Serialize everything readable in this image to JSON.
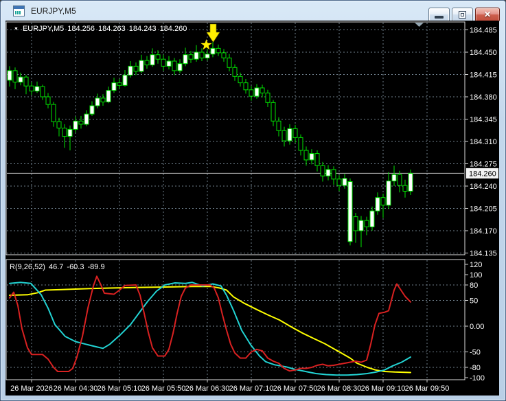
{
  "window": {
    "title": "EURJPY,M5",
    "close_glyph": "✕"
  },
  "colors": {
    "background": "#000000",
    "grid": "#6f7f8c",
    "pane_border": "#dcdcdc",
    "axis_text": "#ffffff",
    "candle_stroke": "#00e400",
    "candle_bull_fill": "#ffffff",
    "candle_bear_fill": "#000000",
    "current_price_line": "#bdbdbd",
    "price_tag_bg": "#f2f2f2",
    "price_tag_text": "#000000",
    "indicator_red": "#d92121",
    "indicator_cyan": "#22d3d3",
    "indicator_yellow": "#ffff00",
    "marker_yellow": "#ffee00",
    "shift_marker": "#93a5b1"
  },
  "chart_data": {
    "type": "candlestick",
    "title": "EURJPY,M5",
    "timeframe_minutes": 5,
    "info": {
      "dropdown_glyph": "▼",
      "symbol": "EURJPY,M5",
      "open": "184.256",
      "high": "184.263",
      "low": "184.243",
      "close": "184.260"
    },
    "current_price": 184.26,
    "current_price_label": "184.260",
    "price_axis": {
      "labels": [
        "184.485",
        "184.450",
        "184.415",
        "184.380",
        "184.345",
        "184.310",
        "184.275",
        "184.240",
        "184.205",
        "184.170",
        "184.135"
      ],
      "min": 184.135,
      "max": 184.485,
      "step": 0.035
    },
    "time_axis": {
      "labels": [
        "26 Mar 2026",
        "26 Mar 04:30",
        "26 Mar 05:10",
        "26 Mar 05:50",
        "26 Mar 06:30",
        "26 Mar 07:10",
        "26 Mar 07:50",
        "26 Mar 08:30",
        "26 Mar 09:10",
        "26 Mar 09:50"
      ]
    },
    "candles": [
      [
        184.406,
        184.428,
        184.396,
        184.421
      ],
      [
        184.421,
        184.426,
        184.392,
        184.403
      ],
      [
        184.403,
        184.418,
        184.398,
        184.411
      ],
      [
        184.411,
        184.414,
        184.384,
        184.397
      ],
      [
        184.397,
        184.403,
        184.383,
        184.389
      ],
      [
        184.389,
        184.404,
        184.386,
        184.396
      ],
      [
        184.396,
        184.399,
        184.375,
        184.38
      ],
      [
        184.38,
        184.386,
        184.362,
        184.368
      ],
      [
        184.368,
        184.372,
        184.333,
        184.341
      ],
      [
        184.341,
        184.347,
        184.318,
        184.331
      ],
      [
        184.331,
        184.337,
        184.3,
        184.318
      ],
      [
        184.318,
        184.335,
        184.296,
        184.329
      ],
      [
        184.329,
        184.349,
        184.324,
        184.342
      ],
      [
        184.342,
        184.35,
        184.33,
        184.337
      ],
      [
        184.337,
        184.359,
        184.334,
        184.353
      ],
      [
        184.353,
        184.373,
        184.35,
        184.366
      ],
      [
        184.366,
        184.385,
        184.362,
        184.378
      ],
      [
        184.378,
        184.384,
        184.366,
        184.372
      ],
      [
        184.372,
        184.396,
        184.37,
        184.39
      ],
      [
        184.39,
        184.41,
        184.386,
        184.402
      ],
      [
        184.402,
        184.408,
        184.392,
        184.398
      ],
      [
        184.398,
        184.422,
        184.396,
        184.414
      ],
      [
        184.414,
        184.436,
        184.41,
        184.428
      ],
      [
        184.428,
        184.434,
        184.414,
        184.42
      ],
      [
        184.42,
        184.446,
        184.417,
        184.437
      ],
      [
        184.437,
        184.444,
        184.424,
        184.43
      ],
      [
        184.43,
        184.456,
        184.427,
        184.446
      ],
      [
        184.446,
        184.453,
        184.432,
        184.439
      ],
      [
        184.439,
        184.446,
        184.421,
        184.428
      ],
      [
        184.428,
        184.444,
        184.423,
        184.436
      ],
      [
        184.436,
        184.441,
        184.414,
        184.421
      ],
      [
        184.421,
        184.439,
        184.417,
        184.432
      ],
      [
        184.432,
        184.457,
        184.428,
        184.446
      ],
      [
        184.446,
        184.452,
        184.433,
        184.439
      ],
      [
        184.439,
        184.461,
        184.435,
        184.45
      ],
      [
        184.45,
        184.456,
        184.436,
        184.441
      ],
      [
        184.441,
        184.455,
        184.437,
        184.447
      ],
      [
        184.447,
        184.466,
        184.442,
        184.456
      ],
      [
        184.456,
        184.462,
        184.444,
        184.449
      ],
      [
        184.449,
        184.455,
        184.435,
        184.441
      ],
      [
        184.441,
        184.447,
        184.42,
        184.426
      ],
      [
        184.426,
        184.431,
        184.405,
        184.412
      ],
      [
        184.412,
        184.418,
        184.396,
        184.402
      ],
      [
        184.402,
        184.408,
        184.385,
        184.391
      ],
      [
        184.391,
        184.397,
        184.374,
        184.381
      ],
      [
        184.381,
        184.4,
        184.377,
        184.394
      ],
      [
        184.394,
        184.399,
        184.379,
        184.386
      ],
      [
        184.386,
        184.391,
        184.364,
        184.371
      ],
      [
        184.371,
        184.375,
        184.334,
        184.342
      ],
      [
        184.342,
        184.348,
        184.318,
        184.327
      ],
      [
        184.327,
        184.333,
        184.302,
        184.311
      ],
      [
        184.311,
        184.337,
        184.305,
        184.33
      ],
      [
        184.33,
        184.336,
        184.308,
        184.316
      ],
      [
        184.316,
        184.321,
        184.288,
        184.296
      ],
      [
        184.296,
        184.302,
        184.272,
        184.281
      ],
      [
        184.281,
        184.298,
        184.274,
        184.291
      ],
      [
        184.291,
        184.296,
        184.263,
        184.272
      ],
      [
        184.272,
        184.278,
        184.247,
        184.256
      ],
      [
        184.256,
        184.273,
        184.249,
        184.266
      ],
      [
        184.266,
        184.271,
        184.242,
        184.251
      ],
      [
        184.251,
        184.257,
        184.232,
        184.241
      ],
      [
        184.241,
        184.259,
        184.236,
        184.252
      ],
      [
        184.153,
        184.252,
        184.147,
        184.247
      ],
      [
        184.192,
        184.198,
        184.151,
        184.17
      ],
      [
        184.17,
        184.193,
        184.144,
        184.186
      ],
      [
        184.186,
        184.192,
        184.163,
        184.176
      ],
      [
        184.176,
        184.208,
        184.17,
        184.201
      ],
      [
        184.201,
        184.23,
        184.195,
        184.222
      ],
      [
        184.222,
        184.228,
        184.19,
        184.21
      ],
      [
        184.21,
        184.262,
        184.204,
        184.248
      ],
      [
        184.248,
        184.272,
        184.24,
        184.258
      ],
      [
        184.258,
        184.264,
        184.23,
        184.241
      ],
      [
        184.241,
        184.25,
        184.222,
        184.232
      ],
      [
        184.232,
        184.266,
        184.226,
        184.26
      ]
    ],
    "markers": [
      {
        "type": "arrow-down",
        "bar_index": 37,
        "color": "#ffee00"
      },
      {
        "type": "star",
        "bar_index": 36,
        "color": "#ffee00"
      }
    ],
    "indicator_pane": {
      "label": "R(9,26,52)",
      "current_values": [
        "46.7",
        "-60.3",
        "-89.9"
      ],
      "axis_labels": [
        "120",
        "100",
        "80",
        "50",
        "0.00",
        "-50",
        "-80",
        "-100"
      ],
      "axis_range": [
        -100,
        129
      ],
      "grid_levels": [
        80,
        50,
        0,
        -50,
        -80
      ],
      "series": [
        {
          "name": "r9",
          "color": "#d92121",
          "points": [
            [
              14,
              55
            ],
            [
              20,
              66
            ],
            [
              26,
              40
            ],
            [
              32,
              -5
            ],
            [
              40,
              -42
            ],
            [
              46,
              -55
            ],
            [
              62,
              -55
            ],
            [
              70,
              -64
            ],
            [
              78,
              -80
            ],
            [
              84,
              -88
            ],
            [
              100,
              -88
            ],
            [
              106,
              -82
            ],
            [
              112,
              -60
            ],
            [
              120,
              -20
            ],
            [
              128,
              35
            ],
            [
              136,
              78
            ],
            [
              141,
              97
            ],
            [
              147,
              80
            ],
            [
              152,
              64
            ],
            [
              166,
              62
            ],
            [
              174,
              70
            ],
            [
              182,
              79
            ],
            [
              198,
              80
            ],
            [
              204,
              60
            ],
            [
              210,
              25
            ],
            [
              216,
              -12
            ],
            [
              222,
              -42
            ],
            [
              230,
              -58
            ],
            [
              240,
              -58
            ],
            [
              246,
              -45
            ],
            [
              252,
              -14
            ],
            [
              258,
              25
            ],
            [
              264,
              58
            ],
            [
              270,
              74
            ],
            [
              278,
              80
            ],
            [
              306,
              80
            ],
            [
              312,
              74
            ],
            [
              318,
              55
            ],
            [
              324,
              22
            ],
            [
              330,
              -8
            ],
            [
              336,
              -35
            ],
            [
              342,
              -52
            ],
            [
              350,
              -62
            ],
            [
              358,
              -62
            ],
            [
              366,
              -50
            ],
            [
              374,
              -45
            ],
            [
              382,
              -48
            ],
            [
              390,
              -62
            ],
            [
              398,
              -68
            ],
            [
              406,
              -72
            ],
            [
              414,
              -82
            ],
            [
              422,
              -87
            ],
            [
              430,
              -85
            ],
            [
              438,
              -82
            ],
            [
              446,
              -82
            ],
            [
              454,
              -80
            ],
            [
              462,
              -76
            ],
            [
              470,
              -74
            ],
            [
              478,
              -77
            ],
            [
              486,
              -76
            ],
            [
              494,
              -74
            ],
            [
              502,
              -72
            ],
            [
              510,
              -70
            ],
            [
              518,
              -68
            ],
            [
              526,
              -70
            ],
            [
              534,
              -66
            ],
            [
              540,
              -35
            ],
            [
              546,
              2
            ],
            [
              552,
              25
            ],
            [
              560,
              27
            ],
            [
              566,
              30
            ],
            [
              570,
              50
            ],
            [
              574,
              70
            ],
            [
              578,
              82
            ],
            [
              584,
              70
            ],
            [
              590,
              58
            ],
            [
              598,
              47
            ]
          ]
        },
        {
          "name": "r26",
          "color": "#22d3d3",
          "points": [
            [
              14,
              83
            ],
            [
              30,
              85
            ],
            [
              45,
              83
            ],
            [
              60,
              61
            ],
            [
              70,
              35
            ],
            [
              80,
              3
            ],
            [
              95,
              -20
            ],
            [
              110,
              -30
            ],
            [
              125,
              -35
            ],
            [
              140,
              -40
            ],
            [
              150,
              -43
            ],
            [
              160,
              -35
            ],
            [
              175,
              -17
            ],
            [
              190,
              3
            ],
            [
              205,
              30
            ],
            [
              215,
              48
            ],
            [
              228,
              68
            ],
            [
              240,
              80
            ],
            [
              255,
              84
            ],
            [
              270,
              83
            ],
            [
              280,
              85
            ],
            [
              295,
              78
            ],
            [
              310,
              82
            ],
            [
              322,
              78
            ],
            [
              330,
              60
            ],
            [
              340,
              31
            ],
            [
              352,
              -8
            ],
            [
              365,
              -36
            ],
            [
              378,
              -58
            ],
            [
              387,
              -69
            ],
            [
              400,
              -75
            ],
            [
              417,
              -79
            ],
            [
              430,
              -84
            ],
            [
              445,
              -88
            ],
            [
              460,
              -92
            ],
            [
              475,
              -94
            ],
            [
              490,
              -95
            ],
            [
              505,
              -95
            ],
            [
              520,
              -94
            ],
            [
              535,
              -92
            ],
            [
              548,
              -89
            ],
            [
              560,
              -85
            ],
            [
              572,
              -77
            ],
            [
              585,
              -70
            ],
            [
              598,
              -60
            ]
          ]
        },
        {
          "name": "r52",
          "color": "#ffff00",
          "points": [
            [
              14,
              60
            ],
            [
              40,
              61
            ],
            [
              55,
              65
            ],
            [
              66,
              70
            ],
            [
              90,
              71
            ],
            [
              110,
              72
            ],
            [
              131,
              73
            ],
            [
              160,
              74
            ],
            [
              195,
              75
            ],
            [
              240,
              76
            ],
            [
              280,
              77
            ],
            [
              308,
              77
            ],
            [
              320,
              74
            ],
            [
              330,
              70
            ],
            [
              340,
              57
            ],
            [
              355,
              45
            ],
            [
              373,
              33
            ],
            [
              390,
              22
            ],
            [
              407,
              12
            ],
            [
              425,
              -2
            ],
            [
              440,
              -13
            ],
            [
              457,
              -24
            ],
            [
              473,
              -34
            ],
            [
              493,
              -49
            ],
            [
              510,
              -62
            ],
            [
              520,
              -72
            ],
            [
              535,
              -80
            ],
            [
              547,
              -85
            ],
            [
              560,
              -88
            ],
            [
              575,
              -89
            ],
            [
              598,
              -90
            ]
          ]
        }
      ]
    }
  }
}
